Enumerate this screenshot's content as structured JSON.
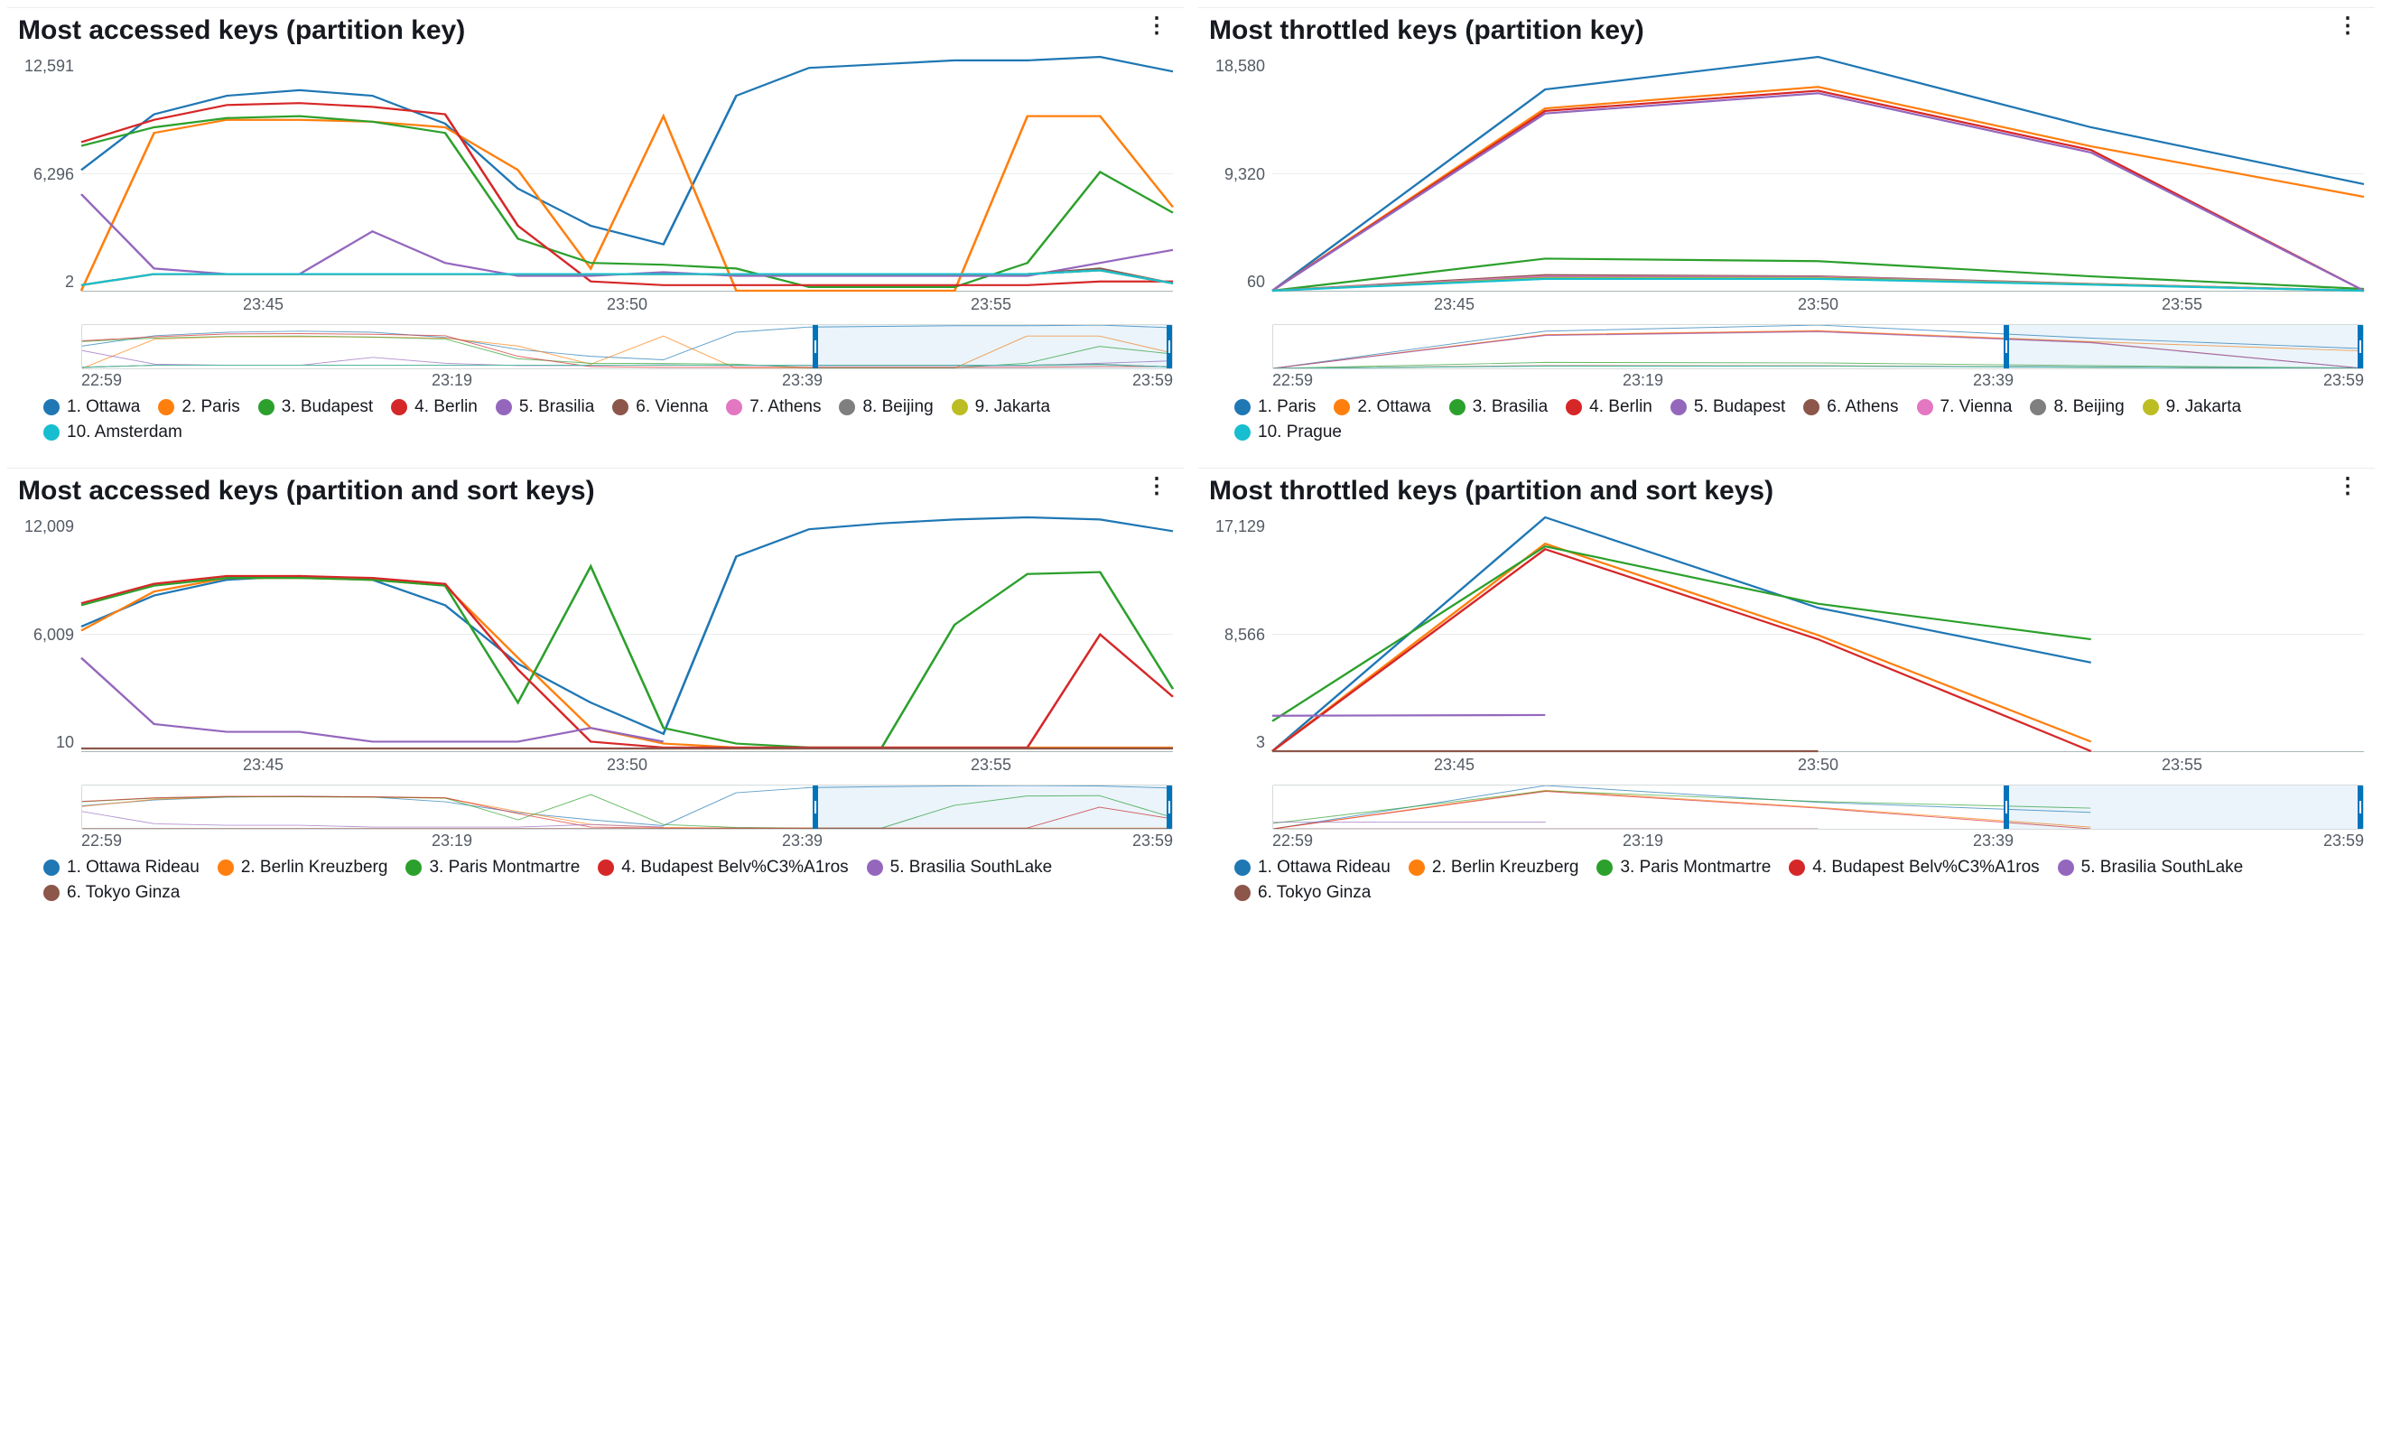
{
  "colors": [
    "#1f77b4",
    "#ff7f0e",
    "#2ca02c",
    "#d62728",
    "#9467bd",
    "#8c564b",
    "#e377c2",
    "#7f7f7f",
    "#bcbd22",
    "#17becf"
  ],
  "panels": [
    {
      "id": "accessed-pk",
      "title": "Most accessed keys (partition key)",
      "y_ticks": [
        "12,591",
        "6,296",
        "2"
      ],
      "x_ticks": [
        "23:45",
        "23:50",
        "23:55"
      ],
      "ov_ticks": [
        "22:59",
        "23:19",
        "23:39",
        "23:59"
      ],
      "brush": {
        "left_pct": 67,
        "width_pct": 33
      },
      "legend": [
        "1. Ottawa",
        "2. Paris",
        "3. Budapest",
        "4. Berlin",
        "5. Brasilia",
        "6. Vienna",
        "7. Athens",
        "8. Beijing",
        "9. Jakarta",
        "10. Amsterdam"
      ]
    },
    {
      "id": "throttled-pk",
      "title": "Most throttled keys (partition key)",
      "y_ticks": [
        "18,580",
        "9,320",
        "60"
      ],
      "x_ticks": [
        "23:45",
        "23:50",
        "23:55"
      ],
      "ov_ticks": [
        "22:59",
        "23:19",
        "23:39",
        "23:59"
      ],
      "brush": {
        "left_pct": 67,
        "width_pct": 33
      },
      "legend": [
        "1. Paris",
        "2. Ottawa",
        "3. Brasilia",
        "4. Berlin",
        "5. Budapest",
        "6. Athens",
        "7. Vienna",
        "8. Beijing",
        "9. Jakarta",
        "10. Prague"
      ]
    },
    {
      "id": "accessed-pksk",
      "title": "Most accessed keys (partition and sort keys)",
      "y_ticks": [
        "12,009",
        "6,009",
        "10"
      ],
      "x_ticks": [
        "23:45",
        "23:50",
        "23:55"
      ],
      "ov_ticks": [
        "22:59",
        "23:19",
        "23:39",
        "23:59"
      ],
      "brush": {
        "left_pct": 67,
        "width_pct": 33
      },
      "legend": [
        "1. Ottawa Rideau",
        "2. Berlin Kreuzberg",
        "3. Paris Montmartre",
        "4. Budapest Belv%C3%A1ros",
        "5. Brasilia SouthLake",
        "6. Tokyo Ginza"
      ]
    },
    {
      "id": "throttled-pksk",
      "title": "Most throttled keys (partition and sort keys)",
      "y_ticks": [
        "17,129",
        "8,566",
        "3"
      ],
      "x_ticks": [
        "23:45",
        "23:50",
        "23:55"
      ],
      "ov_ticks": [
        "22:59",
        "23:19",
        "23:39",
        "23:59"
      ],
      "brush": {
        "left_pct": 67,
        "width_pct": 33
      },
      "legend": [
        "1. Ottawa Rideau",
        "2. Berlin Kreuzberg",
        "3. Paris Montmartre",
        "4. Budapest Belv%C3%A1ros",
        "5. Brasilia SouthLake",
        "6. Tokyo Ginza"
      ]
    }
  ],
  "chart_data": [
    {
      "panel": "accessed-pk",
      "type": "line",
      "title": "Most accessed keys (partition key)",
      "xlabel": "",
      "ylabel": "",
      "x": [
        "23:43",
        "23:44",
        "23:45",
        "23:46",
        "23:47",
        "23:48",
        "23:49",
        "23:50",
        "23:51",
        "23:52",
        "23:53",
        "23:54",
        "23:55",
        "23:56",
        "23:57",
        "23:58"
      ],
      "ylim": [
        2,
        12591
      ],
      "series": [
        {
          "name": "1. Ottawa",
          "values": [
            6500,
            9500,
            10500,
            10800,
            10500,
            9000,
            5500,
            3500,
            2500,
            10500,
            12000,
            12200,
            12400,
            12400,
            12591,
            11800
          ]
        },
        {
          "name": "2. Paris",
          "values": [
            2,
            8500,
            9200,
            9200,
            9100,
            8800,
            6500,
            1200,
            9400,
            2,
            2,
            2,
            2,
            9400,
            9400,
            4500
          ]
        },
        {
          "name": "3. Budapest",
          "values": [
            7800,
            8800,
            9300,
            9400,
            9100,
            8500,
            2800,
            1500,
            1400,
            1200,
            200,
            200,
            200,
            1500,
            6400,
            4200
          ]
        },
        {
          "name": "4. Berlin",
          "values": [
            8000,
            9200,
            10000,
            10100,
            9900,
            9500,
            3500,
            500,
            300,
            300,
            300,
            300,
            300,
            300,
            500,
            500
          ]
        },
        {
          "name": "5. Brasilia",
          "values": [
            5200,
            1200,
            900,
            900,
            3200,
            1500,
            800,
            800,
            1000,
            800,
            800,
            800,
            800,
            800,
            1500,
            2200
          ]
        },
        {
          "name": "6. Vienna",
          "values": [
            300,
            900,
            900,
            900,
            900,
            900,
            900,
            900,
            900,
            900,
            900,
            900,
            900,
            900,
            1200,
            400
          ]
        },
        {
          "name": "7. Athens",
          "values": [
            300,
            900,
            900,
            900,
            900,
            900,
            900,
            900,
            900,
            900,
            900,
            900,
            900,
            900,
            1100,
            400
          ]
        },
        {
          "name": "8. Beijing",
          "values": [
            300,
            900,
            900,
            900,
            900,
            900,
            900,
            900,
            900,
            900,
            900,
            900,
            900,
            900,
            1100,
            400
          ]
        },
        {
          "name": "9. Jakarta",
          "values": [
            300,
            900,
            900,
            900,
            900,
            900,
            900,
            900,
            900,
            900,
            900,
            900,
            900,
            900,
            1100,
            400
          ]
        },
        {
          "name": "10. Amsterdam",
          "values": [
            300,
            900,
            900,
            900,
            900,
            900,
            900,
            900,
            900,
            900,
            900,
            900,
            900,
            900,
            1100,
            400
          ]
        }
      ],
      "overview_xrange": [
        "22:59",
        "23:59"
      ]
    },
    {
      "panel": "throttled-pk",
      "type": "line",
      "title": "Most throttled keys (partition key)",
      "xlabel": "",
      "ylabel": "",
      "x": [
        "23:45",
        "23:46",
        "23:47",
        "23:48",
        "23:49"
      ],
      "ylim": [
        60,
        18580
      ],
      "series": [
        {
          "name": "1. Paris",
          "values": [
            60,
            16000,
            18580,
            13000,
            8500
          ]
        },
        {
          "name": "2. Ottawa",
          "values": [
            60,
            14500,
            16200,
            11500,
            7500
          ]
        },
        {
          "name": "3. Brasilia",
          "values": [
            60,
            2600,
            2400,
            1200,
            200
          ]
        },
        {
          "name": "4. Berlin",
          "values": [
            60,
            14300,
            15900,
            11200,
            60
          ]
        },
        {
          "name": "5. Budapest",
          "values": [
            60,
            14100,
            15700,
            11000,
            60
          ]
        },
        {
          "name": "6. Athens",
          "values": [
            60,
            1300,
            1200,
            600,
            60
          ]
        },
        {
          "name": "7. Vienna",
          "values": [
            60,
            1200,
            1150,
            590,
            60
          ]
        },
        {
          "name": "8. Beijing",
          "values": [
            60,
            1100,
            1100,
            580,
            60
          ]
        },
        {
          "name": "9. Jakarta",
          "values": [
            60,
            1050,
            1050,
            560,
            60
          ]
        },
        {
          "name": "10. Prague",
          "values": [
            60,
            1000,
            1000,
            540,
            60
          ]
        }
      ],
      "overview_xrange": [
        "22:59",
        "23:59"
      ]
    },
    {
      "panel": "accessed-pksk",
      "type": "line",
      "title": "Most accessed keys (partition and sort keys)",
      "xlabel": "",
      "ylabel": "",
      "x": [
        "23:43",
        "23:44",
        "23:45",
        "23:46",
        "23:47",
        "23:48",
        "23:49",
        "23:50",
        "23:51",
        "23:52",
        "23:53",
        "23:54",
        "23:55",
        "23:56",
        "23:57",
        "23:58"
      ],
      "ylim": [
        10,
        12009
      ],
      "series": [
        {
          "name": "1. Ottawa Rideau",
          "values": [
            6400,
            8000,
            8800,
            9000,
            8800,
            7500,
            4500,
            2500,
            900,
            10000,
            11400,
            11700,
            11900,
            12009,
            11900,
            11300
          ]
        },
        {
          "name": "2. Berlin Kreuzberg",
          "values": [
            6200,
            8200,
            8900,
            8900,
            8800,
            8500,
            4800,
            1200,
            400,
            200,
            200,
            200,
            200,
            200,
            200,
            200
          ]
        },
        {
          "name": "3. Paris Montmartre",
          "values": [
            7500,
            8500,
            8900,
            8900,
            8800,
            8500,
            2500,
            9500,
            1200,
            400,
            200,
            200,
            6500,
            9100,
            9200,
            3200
          ]
        },
        {
          "name": "4. Budapest Belv%C3%A1ros",
          "values": [
            7600,
            8600,
            9000,
            9000,
            8900,
            8600,
            4200,
            500,
            200,
            200,
            200,
            200,
            200,
            200,
            6000,
            2800
          ]
        },
        {
          "name": "5. Brasilia SouthLake",
          "values": [
            4800,
            1400,
            1000,
            1000,
            500,
            500,
            500,
            1200,
            500,
            null,
            null,
            null,
            null,
            null,
            null,
            1500
          ]
        },
        {
          "name": "6. Tokyo Ginza",
          "values": [
            150,
            150,
            150,
            150,
            150,
            150,
            150,
            150,
            150,
            150,
            150,
            150,
            150,
            150,
            150,
            150
          ]
        }
      ],
      "overview_xrange": [
        "22:59",
        "23:59"
      ]
    },
    {
      "panel": "throttled-pksk",
      "type": "line",
      "title": "Most throttled keys (partition and sort keys)",
      "xlabel": "",
      "ylabel": "",
      "x": [
        "23:45",
        "23:46",
        "23:47",
        "23:48",
        "23:49"
      ],
      "ylim": [
        3,
        17129
      ],
      "series": [
        {
          "name": "1. Ottawa Rideau",
          "values": [
            3,
            17129,
            10500,
            6500,
            null
          ]
        },
        {
          "name": "2. Berlin Kreuzberg",
          "values": [
            3,
            15200,
            8500,
            700,
            null
          ]
        },
        {
          "name": "3. Paris Montmartre",
          "values": [
            2200,
            15000,
            10800,
            8200,
            null
          ]
        },
        {
          "name": "4. Budapest Belv%C3%A1ros",
          "values": [
            3,
            14800,
            8200,
            3,
            null
          ]
        },
        {
          "name": "5. Brasilia SouthLake",
          "values": [
            2600,
            2650,
            null,
            null,
            null
          ]
        },
        {
          "name": "6. Tokyo Ginza",
          "values": [
            3,
            3,
            3,
            null,
            null
          ]
        }
      ],
      "overview_xrange": [
        "22:59",
        "23:59"
      ]
    }
  ]
}
